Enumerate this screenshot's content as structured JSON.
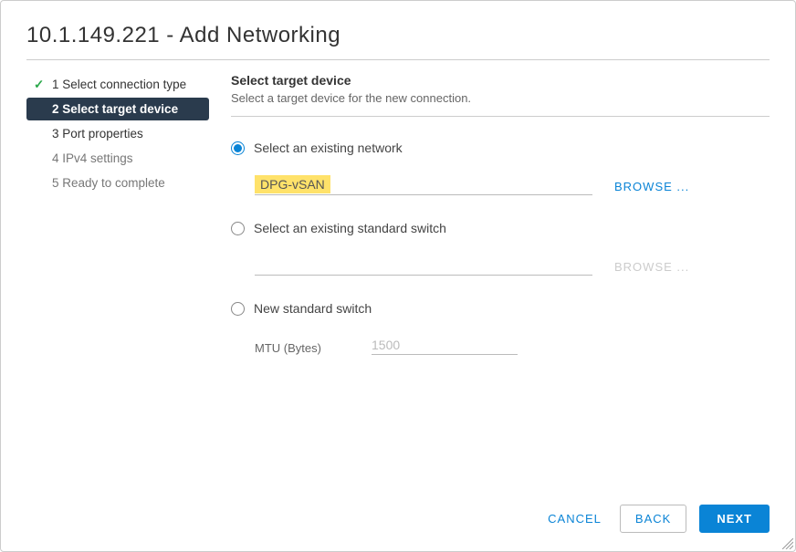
{
  "dialog": {
    "title": "10.1.149.221 - Add Networking"
  },
  "steps": [
    {
      "label": "1 Select connection type",
      "state": "done"
    },
    {
      "label": "2 Select target device",
      "state": "active"
    },
    {
      "label": "3 Port properties",
      "state": "pending"
    },
    {
      "label": "4 IPv4 settings",
      "state": "disabled"
    },
    {
      "label": "5 Ready to complete",
      "state": "disabled"
    }
  ],
  "content": {
    "title": "Select target device",
    "subtitle": "Select a target device for the new connection.",
    "options": {
      "existing_network": {
        "label": "Select an existing network",
        "selected": true,
        "value": "DPG-vSAN",
        "browse": "BROWSE ..."
      },
      "existing_switch": {
        "label": "Select an existing standard switch",
        "selected": false,
        "value": "",
        "browse": "BROWSE ..."
      },
      "new_switch": {
        "label": "New standard switch",
        "selected": false,
        "mtu_label": "MTU (Bytes)",
        "mtu_value": "1500"
      }
    }
  },
  "footer": {
    "cancel": "CANCEL",
    "back": "BACK",
    "next": "NEXT"
  }
}
